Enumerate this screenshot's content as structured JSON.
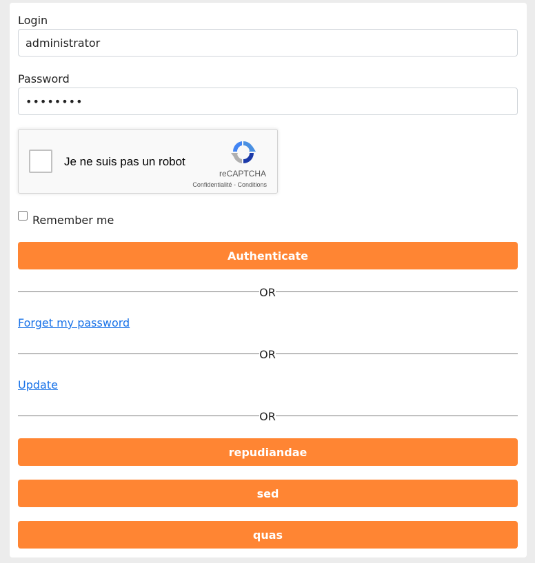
{
  "login": {
    "label": "Login",
    "value": "administrator"
  },
  "password": {
    "label": "Password",
    "value": "••••••••"
  },
  "recaptcha": {
    "label": "Je ne suis pas un robot",
    "brand": "reCAPTCHA",
    "privacy": "Confidentialité",
    "separator": " - ",
    "terms": "Conditions"
  },
  "remember": {
    "label": "Remember me",
    "checked": false
  },
  "authenticate_label": "Authenticate",
  "divider_text": "OR",
  "forget_password_label": "Forget my password",
  "update_label": "Update",
  "provider_buttons": [
    "repudiandae",
    "sed",
    "quas"
  ],
  "colors": {
    "button_bg": "#ff8533",
    "link": "#1a73e8"
  }
}
